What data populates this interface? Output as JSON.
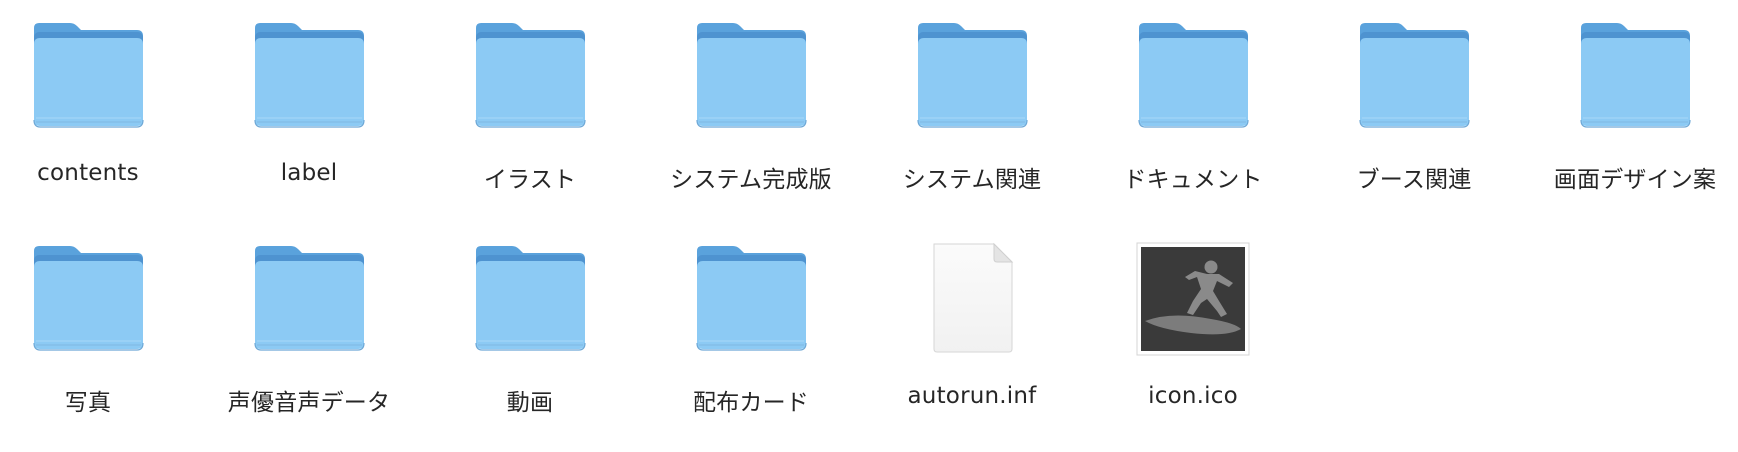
{
  "items": [
    {
      "label": "contents",
      "type": "folder",
      "icon": "folder-icon"
    },
    {
      "label": "label",
      "type": "folder",
      "icon": "folder-icon"
    },
    {
      "label": "イラスト",
      "type": "folder",
      "icon": "folder-icon"
    },
    {
      "label": "システム完成版",
      "type": "folder",
      "icon": "folder-icon"
    },
    {
      "label": "システム関連",
      "type": "folder",
      "icon": "folder-icon"
    },
    {
      "label": "ドキュメント",
      "type": "folder",
      "icon": "folder-icon"
    },
    {
      "label": "ブース関連",
      "type": "folder",
      "icon": "folder-icon"
    },
    {
      "label": "画面デザイン案",
      "type": "folder",
      "icon": "folder-icon"
    },
    {
      "label": "写真",
      "type": "folder",
      "icon": "folder-icon"
    },
    {
      "label": "声優音声データ",
      "type": "folder",
      "icon": "folder-icon"
    },
    {
      "label": "動画",
      "type": "folder",
      "icon": "folder-icon"
    },
    {
      "label": "配布カード",
      "type": "folder",
      "icon": "folder-icon"
    },
    {
      "label": "autorun.inf",
      "type": "file",
      "icon": "document-icon"
    },
    {
      "label": "icon.ico",
      "type": "image",
      "icon": "surfer-icon"
    }
  ],
  "colors": {
    "folder_body": "#8ccaf4",
    "folder_tab": "#5aa2dc",
    "label_text": "#262626",
    "ico_background": "#3a3a3a"
  }
}
